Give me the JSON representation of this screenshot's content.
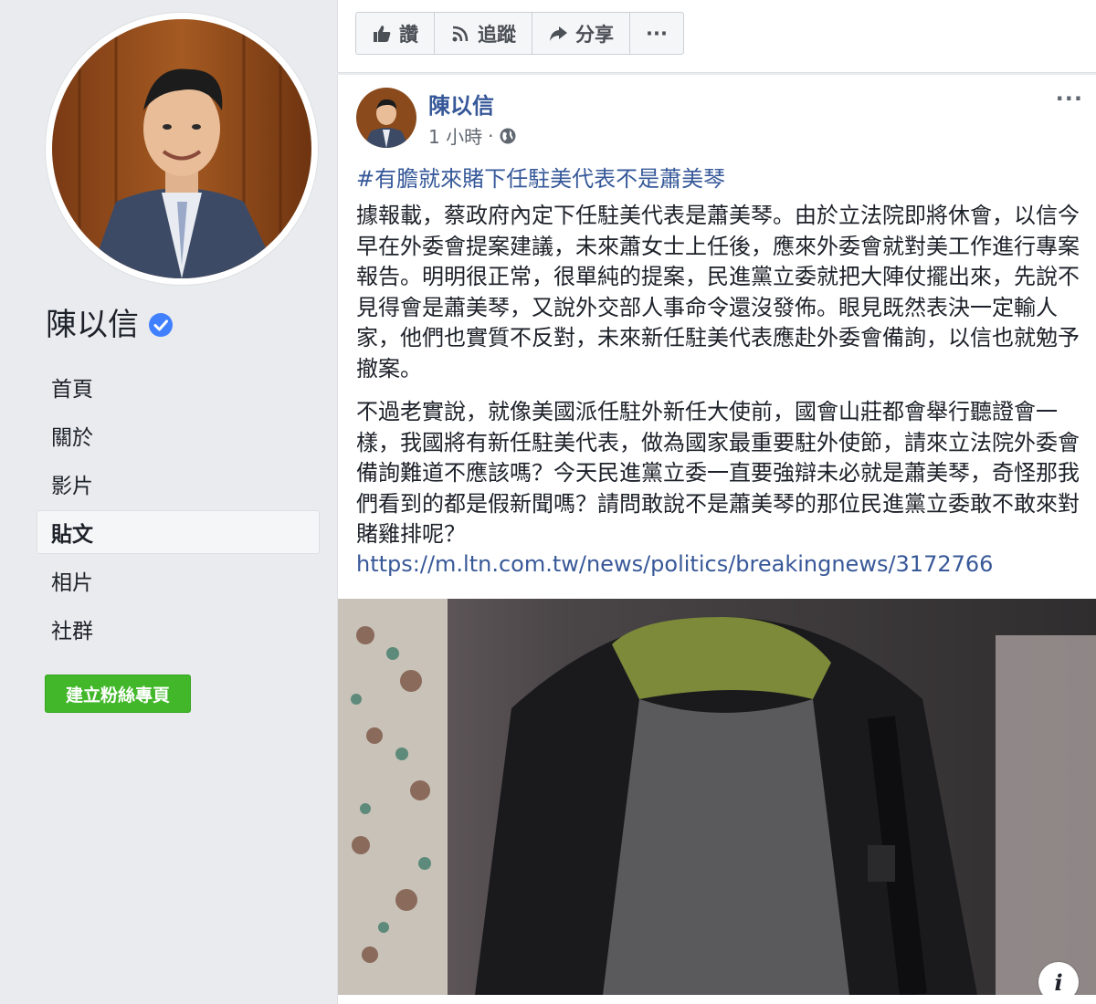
{
  "page": {
    "name": "陳以信",
    "verified": true,
    "nav": [
      "首頁",
      "關於",
      "影片",
      "貼文",
      "相片",
      "社群"
    ],
    "active_nav": "貼文",
    "create_page_button": "建立粉絲專頁"
  },
  "actions": {
    "like": "讚",
    "follow": "追蹤",
    "share": "分享",
    "more": "···"
  },
  "post": {
    "author": "陳以信",
    "time": "1 小時",
    "separator": "·",
    "more": "···",
    "hashtag": "#有膽就來賭下任駐美代表不是蕭美琴",
    "paragraph1": "據報載，蔡政府內定下任駐美代表是蕭美琴。由於立法院即將休會，以信今早在外委會提案建議，未來蕭女士上任後，應來外委會就對美工作進行專案報告。明明很正常，很單純的提案，民進黨立委就把大陣仗擺出來，先說不見得會是蕭美琴，又說外交部人事命令還沒發佈。眼見既然表決一定輸人家，他們也實質不反對，未來新任駐美代表應赴外委會備詢，以信也就勉予撤案。",
    "paragraph2": "不過老實說，就像美國派任駐外新任大使前，國會山莊都會舉行聽證會一樣，我國將有新任駐美代表，做為國家最重要駐外使節，請來立法院外委會備詢難道不應該嗎？今天民進黨立委一直要強辯未必就是蕭美琴，奇怪那我們看到的都是假新聞嗎？請問敢說不是蕭美琴的那位民進黨立委敢不敢來對賭雞排呢？",
    "link": "https://m.ltn.com.tw/news/politics/breakingnews/3172766",
    "info": "i"
  },
  "colors": {
    "link_blue": "#365899",
    "green_button": "#42b72a",
    "verified_blue": "#4080ff",
    "background": "#e9ebee"
  }
}
